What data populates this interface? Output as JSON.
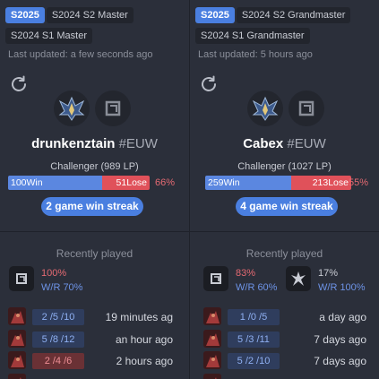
{
  "colors": {
    "background": "#2b2f3a",
    "accent": "#4a7fe0",
    "win": "#5b87e0",
    "lose": "#e0515a"
  },
  "players": [
    {
      "season_current": "S2025",
      "season_tags": [
        "S2024 S2 Master",
        "S2024 S1 Master"
      ],
      "last_updated": "Last updated: a few seconds ago",
      "name": "drunkenztain",
      "tagline": "#EUW",
      "rank": "Challenger (989 LP)",
      "wins_label": "100Win",
      "losses_label": "51Lose",
      "win_fraction": 0.66,
      "winrate": "66%",
      "streak": "2 game win streak",
      "recently_played_title": "Recently played",
      "champs": [
        {
          "pct": "100%",
          "wr": "W/R 70%",
          "icon": "champion-icon"
        }
      ],
      "matches": [
        {
          "kda": "2 /5 /10",
          "result": "win",
          "when": "19 minutes ag"
        },
        {
          "kda": "5 /8 /12",
          "result": "win",
          "when": "an hour ago"
        },
        {
          "kda": "2 /4 /6",
          "result": "loss",
          "when": "2 hours ago"
        }
      ]
    },
    {
      "season_current": "S2025",
      "season_tags": [
        "S2024 S2 Grandmaster",
        "S2024 S1 Grandmaster"
      ],
      "last_updated": "Last updated: 5 hours ago",
      "name": "Cabex",
      "tagline": "#EUW",
      "rank": "Challenger (1027 LP)",
      "wins_label": "259Win",
      "losses_label": "213Lose",
      "win_fraction": 0.55,
      "winrate": "55%",
      "streak": "4 game win streak",
      "recently_played_title": "Recently played",
      "champs": [
        {
          "pct": "83%",
          "wr": "W/R 60%",
          "icon": "champion-icon"
        },
        {
          "pct": "17%",
          "wr": "W/R 100%",
          "icon": "champion-icon"
        }
      ],
      "matches": [
        {
          "kda": "1 /0 /5",
          "result": "win",
          "when": "a day ago"
        },
        {
          "kda": "5 /3 /11",
          "result": "win",
          "when": "7 days ago"
        },
        {
          "kda": "5 /2 /10",
          "result": "win",
          "when": "7 days ago"
        }
      ]
    }
  ]
}
